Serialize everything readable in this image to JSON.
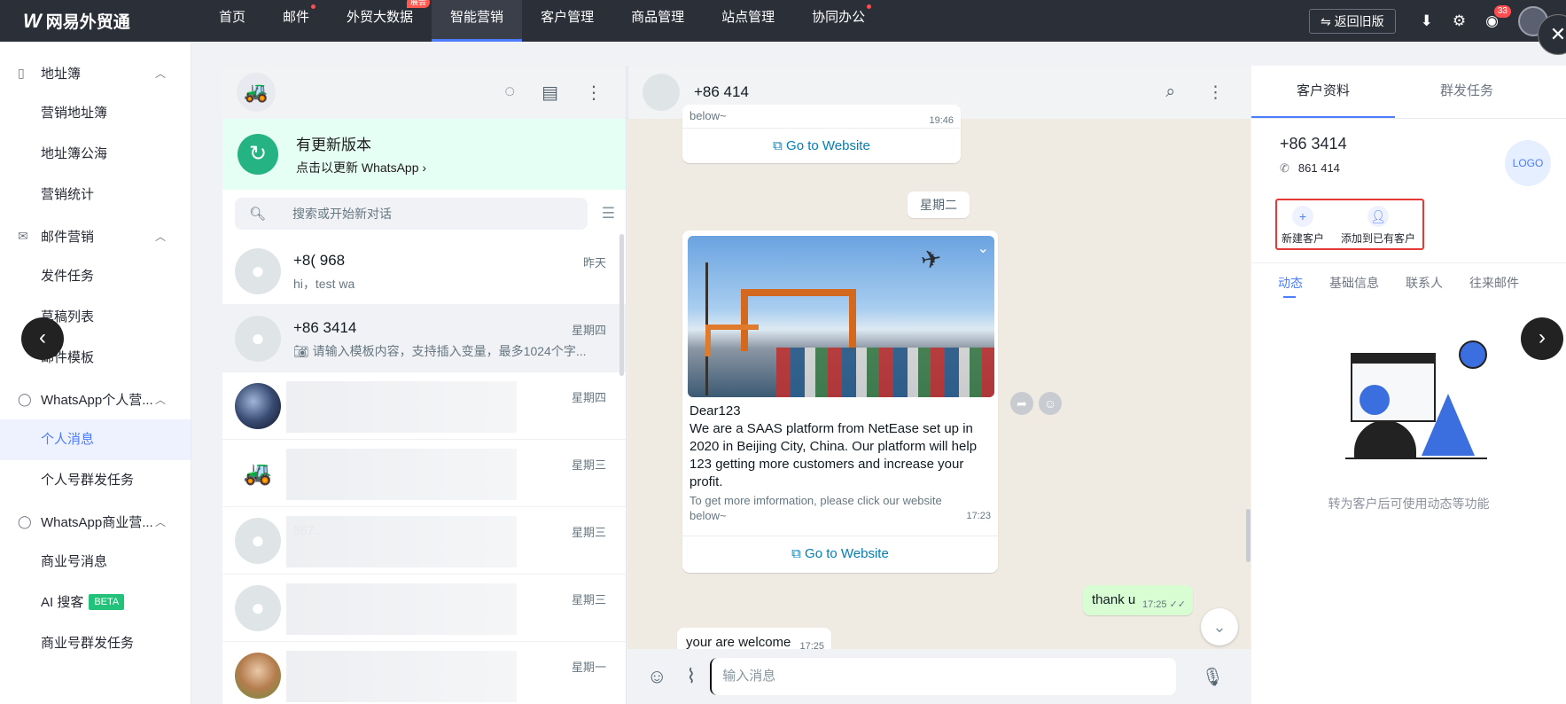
{
  "topbar": {
    "brand": "网易外贸通",
    "nav": [
      {
        "label": "首页"
      },
      {
        "label": "邮件",
        "dot": true
      },
      {
        "label": "外贸大数据",
        "tag": "展会"
      },
      {
        "label": "智能营销",
        "active": true
      },
      {
        "label": "客户管理"
      },
      {
        "label": "商品管理"
      },
      {
        "label": "站点管理"
      },
      {
        "label": "协同办公",
        "dot": true
      }
    ],
    "old_version": "返回旧版",
    "notify_count": "33"
  },
  "sidebar": {
    "groups": [
      {
        "label": "地址簿",
        "icon": "book-icon",
        "items": [
          "营销地址簿",
          "地址簿公海",
          "营销统计"
        ]
      },
      {
        "label": "邮件营销",
        "icon": "mail-icon",
        "items": [
          "发件任务",
          "草稿列表",
          "邮件模板"
        ]
      },
      {
        "label": "WhatsApp个人营...",
        "icon": "whatsapp-icon",
        "items": [
          "个人消息",
          "个人号群发任务"
        ]
      },
      {
        "label": "WhatsApp商业营...",
        "icon": "whatsapp-icon",
        "items": [
          "商业号消息",
          "AI 搜客",
          "商业号群发任务"
        ]
      }
    ],
    "beta": "BETA",
    "active_item": "个人消息"
  },
  "chatlist": {
    "update_title": "有更新版本",
    "update_sub": "点击以更新 WhatsApp ›",
    "search_placeholder": "搜索或开始新对话",
    "conversations": [
      {
        "name": "+8( 968",
        "msg": "hi，test wa",
        "time": "昨天",
        "avatar": "default"
      },
      {
        "name": "+86 3414",
        "msg": "请输入模板内容，支持插入变量，最多1024个字...",
        "time": "星期四",
        "avatar": "default",
        "active": true
      },
      {
        "name": "",
        "msg": "",
        "time": "星期四",
        "avatar": "photo1"
      },
      {
        "name": "",
        "msg": "",
        "time": "星期三",
        "avatar": "fork"
      },
      {
        "name": "",
        "msg": "567...",
        "time": "星期三",
        "avatar": "default"
      },
      {
        "name": "",
        "msg": "",
        "time": "星期三",
        "avatar": "default"
      },
      {
        "name": "",
        "msg": "",
        "time": "星期一",
        "avatar": "photo2"
      }
    ]
  },
  "chat": {
    "contact": "+86 414",
    "top_snip": "below~",
    "top_time": "19:46",
    "goto_label": "Go to Website",
    "date_pill": "星期二",
    "card_title": "Dear123",
    "card_body": "We are a SAAS platform from NetEase set up in 2020 in Beijing City, China. Our platform will help 123 getting more customers and increase your profit.",
    "card_small": "To get more imformation, please click our website below~",
    "card_time": "17:23",
    "out_msg": "thank u",
    "out_time": "17:25",
    "in_msg": "your are welcome",
    "in_time": "17:25",
    "composer_placeholder": "输入消息"
  },
  "right": {
    "tabs": [
      "客户资料",
      "群发任务"
    ],
    "phone": "+86 3414",
    "wa_number": "861 414",
    "logo": "LOGO",
    "btn_new": "新建客户",
    "btn_add": "添加到已有客户",
    "subtabs": [
      "动态",
      "基础信息",
      "联系人",
      "往来邮件"
    ],
    "hint": "转为客户后可使用动态等功能"
  }
}
